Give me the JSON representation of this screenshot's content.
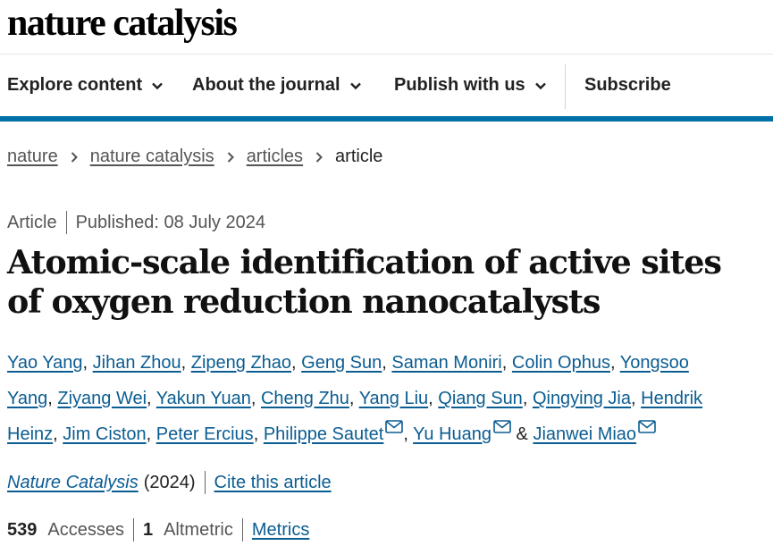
{
  "header": {
    "logo_text": "nature catalysis"
  },
  "nav": {
    "items": [
      {
        "label": "Explore content",
        "icon": "chevron-down-icon"
      },
      {
        "label": "About the journal",
        "icon": "chevron-down-icon"
      },
      {
        "label": "Publish with us",
        "icon": "chevron-down-icon"
      }
    ],
    "subscribe_label": "Subscribe",
    "accent_color": "#0070a8"
  },
  "breadcrumb": {
    "items": [
      "nature",
      "nature catalysis",
      "articles"
    ],
    "current": "article",
    "separator_icon": "chevron-right-icon"
  },
  "article": {
    "type": "Article",
    "published": "Published: 08 July 2024",
    "title": "Atomic-scale identification of active sites of oxygen reduction nanocatalysts",
    "authors": [
      {
        "name": "Yao Yang",
        "sep": ", "
      },
      {
        "name": "Jihan Zhou",
        "sep": ", "
      },
      {
        "name": "Zipeng Zhao",
        "sep": ", "
      },
      {
        "name": "Geng Sun",
        "sep": ", "
      },
      {
        "name": "Saman Moniri",
        "sep": ", "
      },
      {
        "name": "Colin Ophus",
        "sep": ", "
      },
      {
        "name": "Yongsoo Yang",
        "sep": ", "
      },
      {
        "name": "Ziyang Wei",
        "sep": ", "
      },
      {
        "name": "Yakun Yuan",
        "sep": ", "
      },
      {
        "name": "Cheng Zhu",
        "sep": ", "
      },
      {
        "name": "Yang Liu",
        "sep": ", "
      },
      {
        "name": "Qiang Sun",
        "sep": ", "
      },
      {
        "name": "Qingying Jia",
        "sep": ", "
      },
      {
        "name": "Hendrik Heinz",
        "sep": ", "
      },
      {
        "name": "Jim Ciston",
        "sep": ", "
      },
      {
        "name": "Peter Ercius",
        "sep": ", "
      },
      {
        "name": "Philippe Sautet",
        "sep": ", ",
        "mail": true
      },
      {
        "name": "Yu Huang",
        "sep": " & ",
        "mail": true
      },
      {
        "name": "Jianwei Miao",
        "sep": "",
        "mail": true
      }
    ],
    "journal": "Nature Catalysis",
    "year": "(2024)",
    "cite_label": "Cite this article"
  },
  "metrics": {
    "accesses_value": "539",
    "accesses_label": "Accesses",
    "altmetric_value": "1",
    "altmetric_label": "Altmetric",
    "metrics_link": "Metrics"
  },
  "colors": {
    "link": "#0b5d92",
    "text": "#222222",
    "muted": "#555555"
  }
}
